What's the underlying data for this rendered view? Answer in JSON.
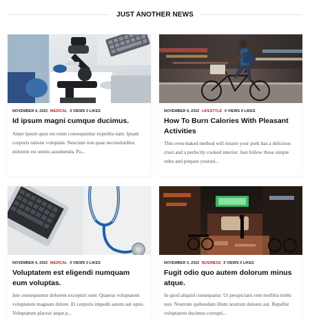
{
  "section": {
    "title": "JUST ANOTHER NEWS"
  },
  "posts": [
    {
      "image": "microscope-lab-photo",
      "date": "NOVEMBER 4, 2022",
      "category": "MEDICAL",
      "category_color": "#c0161d",
      "views": "0 VIEWS",
      "likes": "0 LIKES",
      "title": "Id ipsum magni cumque ducimus.",
      "excerpt": "Amet ipsum quos est enim consequuntur expedita nam. Ipsam corporis ratione voluptate. Nesciunt non quae necessitatibus dolorem est omnis assumenda. Pa..."
    },
    {
      "image": "cyclist-street-photo",
      "date": "NOVEMBER 4, 2022",
      "category": "LIFESTYLE",
      "category_color": "#c0161d",
      "views": "0 VIEWS",
      "likes": "0 LIKES",
      "title": "How To Burn Calories With Pleasant Activities",
      "excerpt": "This oven-baked method will ensure your pork has a delicious crust and a perfectly cooked interior. Just follow these simple rules and prepare yoursel..."
    },
    {
      "image": "laptop-stethoscope-photo",
      "date": "NOVEMBER 4, 2022",
      "category": "MEDICAL",
      "category_color": "#c0161d",
      "views": "0 VIEWS",
      "likes": "0 LIKES",
      "title": "Voluptatem est eligendi numquam eum voluptas.",
      "excerpt": "Iste consequuntur dolorem excepturi sunt. Quaerat voluptatem voluptatem magnam dolore. Et corporis impedit autem aut optio. Voluptatum placeat atque p..."
    },
    {
      "image": "night-street-photo",
      "date": "NOVEMBER 3, 2022",
      "category": "BUSINESS",
      "category_color": "#c0161d",
      "views": "0 VIEWS",
      "likes": "0 LIKES",
      "title": "Fugit odio quo autem dolorum minus atque.",
      "excerpt": "In quod aliquid consequatur. Ut perspiciatis rem mollitia nobis non. Nostrum quibusdam illum nostrum dolores aut. Repellat voluptatem ducimus corrupti..."
    }
  ]
}
